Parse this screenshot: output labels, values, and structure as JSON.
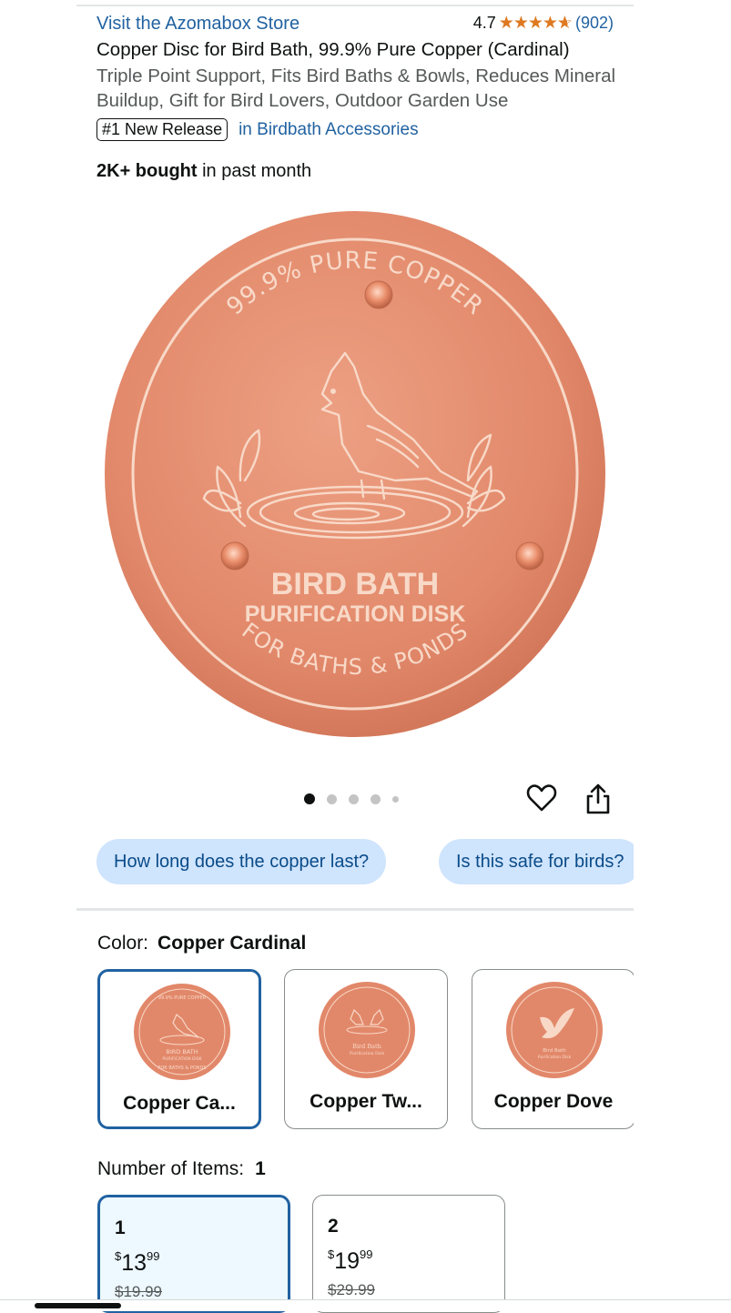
{
  "header": {
    "store_link": "Visit the Azomabox Store",
    "rating_value": "4.7",
    "rating_stars": 4.7,
    "rating_count": "(902)",
    "title": "Copper Disc for Bird Bath, 99.9% Pure Copper (Cardinal)",
    "subtitle": "Triple Point Support, Fits Bird Baths & Bowls, Reduces Mineral Buildup, Gift for Bird Lovers, Outdoor Garden Use",
    "badge": "#1 New Release",
    "badge_category": "in Birdbath Accessories",
    "bought_bold": "2K+ bought",
    "bought_rest": " in past month"
  },
  "product_image": {
    "top_text": "99.9% PURE COPPER",
    "main_text": "BIRD BATH",
    "sub_text": "PURIFICATION DISK",
    "bottom_text": "FOR BATHS & PONDS",
    "copper_color": "#e2886a",
    "line_color": "#f8d9c8"
  },
  "carousel": {
    "count": 5,
    "active": 0
  },
  "icons": {
    "favorite": "heart-icon",
    "share": "share-icon"
  },
  "questions": [
    "How long does the copper last?",
    "Is this safe for birds?"
  ],
  "color": {
    "label": "Color:",
    "selected": "Copper Cardinal",
    "options": [
      {
        "label": "Copper Ca...",
        "selected": true,
        "motif": "cardinal",
        "disc_top": "99.9% PURE COPPER",
        "disc_main": "BIRD BATH",
        "disc_sub": "PURIFICATION DISK",
        "disc_bottom": "FOR BATHS & PONDS"
      },
      {
        "label": "Copper Tw...",
        "selected": false,
        "motif": "twin",
        "disc_top": "",
        "disc_main": "Bird Bath",
        "disc_sub": "Purification Disk",
        "disc_bottom": ""
      },
      {
        "label": "Copper Dove",
        "selected": false,
        "motif": "dove",
        "disc_top": "",
        "disc_main": "Bird Bath",
        "disc_sub": "Purification Disk",
        "disc_bottom": ""
      }
    ]
  },
  "items": {
    "label": "Number of Items:",
    "selected": "1",
    "options": [
      {
        "qty": "1",
        "currency": "$",
        "whole": "13",
        "fraction": "99",
        "was": "$19.99",
        "selected": true
      },
      {
        "qty": "2",
        "currency": "$",
        "whole": "19",
        "fraction": "99",
        "was": "$29.99",
        "selected": false
      }
    ]
  },
  "colors": {
    "link": "#2162a1",
    "star": "#de7921",
    "chip_bg": "#cfe4fd",
    "selected_border": "#2162a1",
    "text": "#0F1111",
    "muted": "#565959"
  }
}
